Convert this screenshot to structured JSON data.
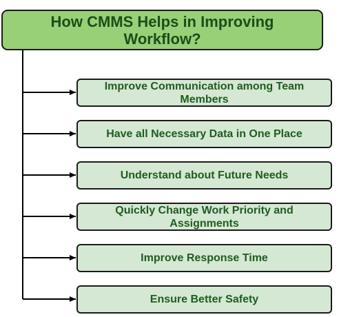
{
  "title": "How CMMS Helps in  Improving Workflow?",
  "steps": [
    "Improve Communication among Team Members",
    "Have all Necessary Data in One Place",
    "Understand about Future Needs",
    "Quickly Change Work Priority and Assignments",
    "Improve Response Time",
    "Ensure Better Safety"
  ],
  "colors": {
    "title_fill": "#97d077",
    "title_text": "#1c4d1c",
    "step_fill": "#d5e8d4",
    "step_text": "#1f5c1f",
    "line": "#000000"
  }
}
